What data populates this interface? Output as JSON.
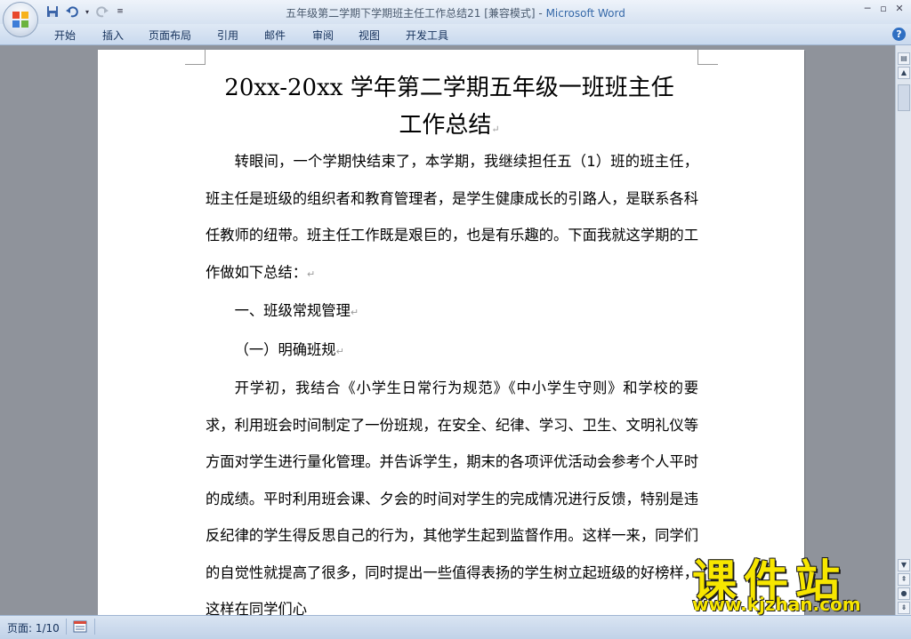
{
  "window": {
    "title_prefix": "五年级第二学期下学期班主任工作总结21 [兼容模式] - ",
    "app_name": "Microsoft Word"
  },
  "ribbon": {
    "tabs": [
      "开始",
      "插入",
      "页面布局",
      "引用",
      "邮件",
      "审阅",
      "视图",
      "开发工具"
    ]
  },
  "document": {
    "title_line1": "20xx-20xx 学年第二学期五年级一班班主任",
    "title_line2": "工作总结",
    "paragraphs": [
      "转眼间，一个学期快结束了，本学期，我继续担任五（1）班的班主任，班主任是班级的组织者和教育管理者，是学生健康成长的引路人，是联系各科任教师的纽带。班主任工作既是艰巨的，也是有乐趣的。下面我就这学期的工作做如下总结：",
      "一、班级常规管理",
      "（一）明确班规",
      "开学初，我结合《小学生日常行为规范》《中小学生守则》和学校的要求，利用班会时间制定了一份班规，在安全、纪律、学习、卫生、文明礼仪等方面对学生进行量化管理。并告诉学生，期末的各项评优活动会参考个人平时的成绩。平时利用班会课、夕会的时间对学生的完成情况进行反馈，特别是违反纪律的学生得反思自己的行为，其他学生起到监督作用。这样一来，同学们的自觉性就提高了很多，同时提出一些值得表扬的学生树立起班级的好榜样，这样在同学们心"
    ]
  },
  "statusbar": {
    "page_counter": "页面: 1/10"
  },
  "watermark": {
    "title": "课件站",
    "url": "www.kjzhan.com"
  },
  "colors": {
    "app_name": "#3568a8",
    "ribbon_text": "#15315b",
    "workspace": "#8f939b",
    "watermark": "#f7e600"
  }
}
